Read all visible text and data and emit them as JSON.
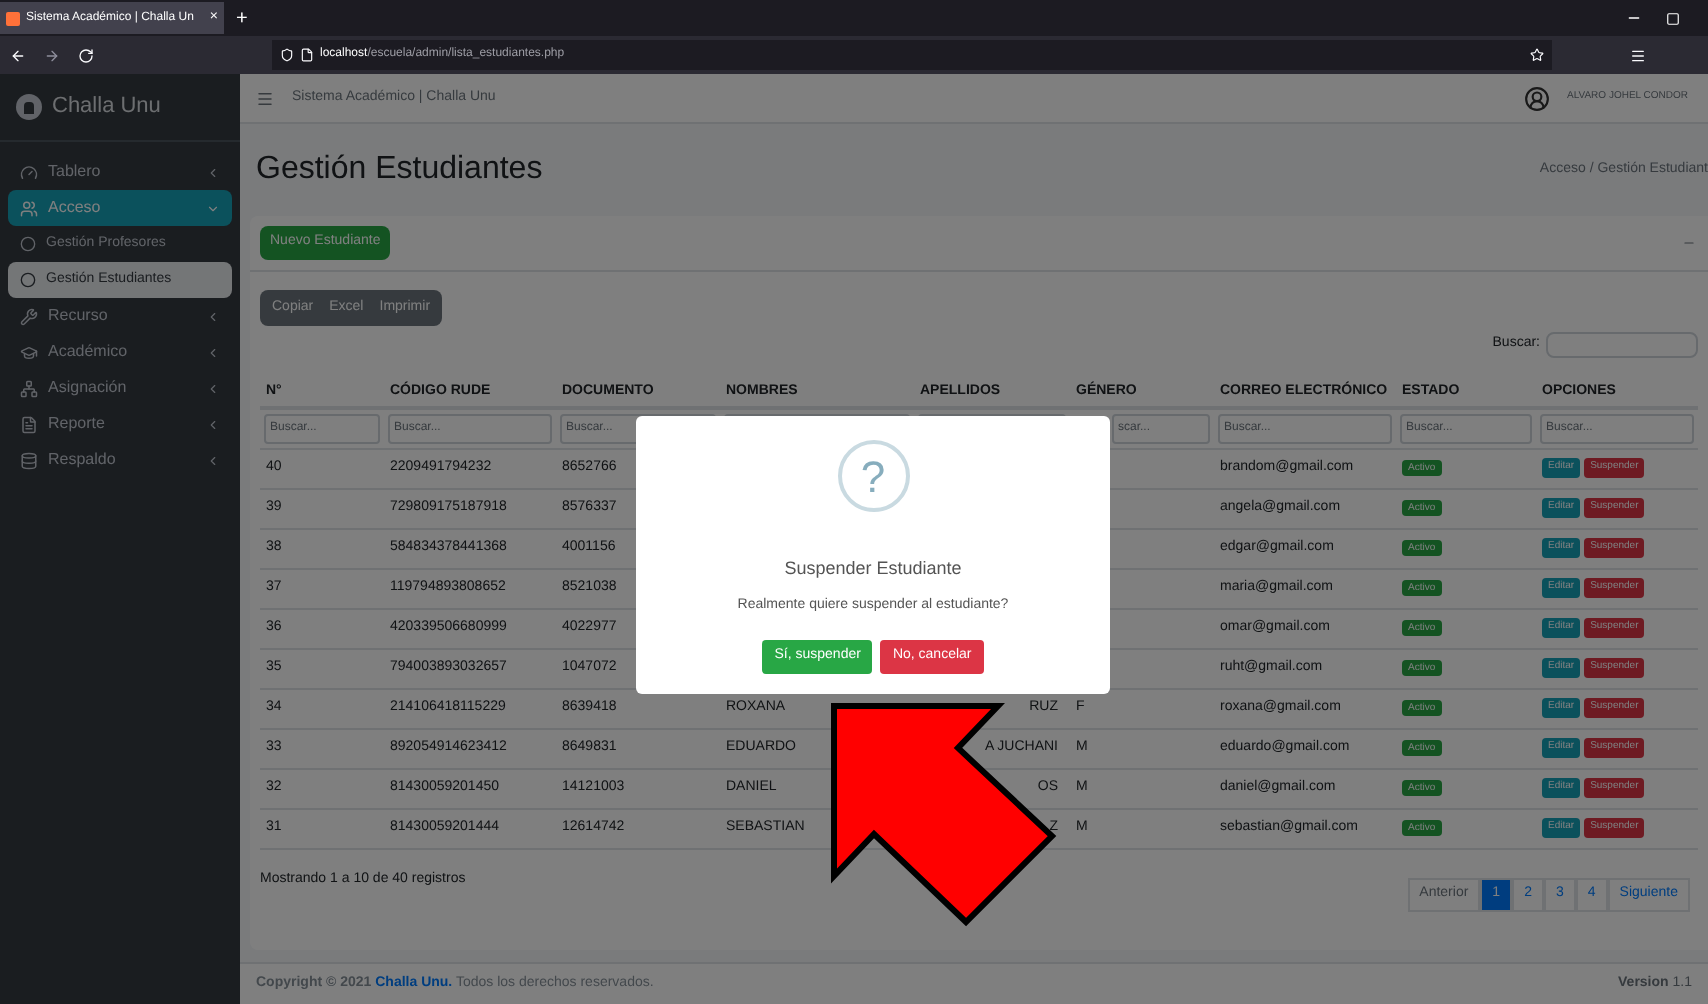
{
  "browser": {
    "tab_title": "Sistema Académico | Challa Un",
    "tab_close": "×",
    "new_tab": "+",
    "url_host": "localhost",
    "url_path": "/escuela/admin/lista_estudiantes.php"
  },
  "sidebar": {
    "brand": "Challa Unu",
    "items": [
      {
        "label": "Tablero",
        "selected": false,
        "expanded": false
      },
      {
        "label": "Acceso",
        "selected": true,
        "expanded": true,
        "children": [
          {
            "label": "Gestión Profesores",
            "selected": false
          },
          {
            "label": "Gestión Estudiantes",
            "selected": true
          }
        ]
      },
      {
        "label": "Recurso",
        "selected": false,
        "expanded": false
      },
      {
        "label": "Académico",
        "selected": false,
        "expanded": false
      },
      {
        "label": "Asignación",
        "selected": false,
        "expanded": false
      },
      {
        "label": "Reporte",
        "selected": false,
        "expanded": false
      },
      {
        "label": "Respaldo",
        "selected": false,
        "expanded": false
      }
    ]
  },
  "navbar": {
    "title": "Sistema Académico | Challa Unu",
    "user": "ALVARO JOHEL CONDOR"
  },
  "header": {
    "title": "Gestión Estudiantes",
    "breadcrumb": [
      "Acceso",
      "Gestión Estudiant"
    ],
    "separator": "/"
  },
  "card": {
    "new_button": "Nuevo Estudiante",
    "export_buttons": [
      "Copiar",
      "Excel",
      "Imprimir"
    ],
    "search_label": "Buscar:"
  },
  "table": {
    "columns": [
      "N°",
      "CÓDIGO RUDE",
      "DOCUMENTO",
      "NOMBRES",
      "APELLIDOS",
      "GÉNERO",
      "CORREO ELECTRÓNICO",
      "ESTADO",
      "OPCIONES"
    ],
    "filters": [
      {
        "placeholder": "Buscar..."
      },
      {
        "placeholder": "Buscar..."
      },
      {
        "placeholder": "Buscar..."
      },
      {
        "kind": "blank"
      },
      {
        "kind": "blank"
      },
      {
        "placeholder": "scar..."
      },
      {
        "placeholder": "Buscar..."
      },
      {
        "placeholder": "Buscar..."
      },
      {
        "placeholder": "Buscar..."
      }
    ],
    "rows": [
      {
        "cells": [
          "40",
          "2209491794232",
          "8652766",
          null,
          null,
          null,
          "brandom@gmail.com"
        ],
        "estado": "Activo",
        "actions": [
          {
            "kind": "edit",
            "label": "Editar"
          },
          {
            "kind": "suspend",
            "label": "Suspender"
          }
        ]
      },
      {
        "cells": [
          "39",
          "729809175187918",
          "8576337",
          null,
          null,
          null,
          "angela@gmail.com"
        ],
        "estado": "Activo",
        "actions": [
          {
            "kind": "edit",
            "label": "Editar"
          },
          {
            "kind": "suspend",
            "label": "Suspender"
          }
        ]
      },
      {
        "cells": [
          "38",
          "584834378441368",
          "4001156",
          null,
          null,
          null,
          "edgar@gmail.com"
        ],
        "estado": "Activo",
        "actions": [
          {
            "kind": "edit",
            "label": "Editar"
          },
          {
            "kind": "suspend",
            "label": "Suspender"
          }
        ]
      },
      {
        "cells": [
          "37",
          "119794893808652",
          "8521038",
          null,
          null,
          null,
          "maria@gmail.com"
        ],
        "estado": "Activo",
        "actions": [
          {
            "kind": "edit",
            "label": "Editar"
          },
          {
            "kind": "suspend",
            "label": "Suspender"
          }
        ]
      },
      {
        "cells": [
          "36",
          "420339506680999",
          "4022977",
          null,
          null,
          null,
          "omar@gmail.com"
        ],
        "estado": "Activo",
        "actions": [
          {
            "kind": "edit",
            "label": "Editar"
          },
          {
            "kind": "suspend",
            "label": "Suspender"
          }
        ]
      },
      {
        "cells": [
          "35",
          "794003893032657",
          "1047072",
          null,
          null,
          null,
          "ruht@gmail.com"
        ],
        "estado": "Activo",
        "actions": [
          {
            "kind": "edit",
            "label": "Editar"
          },
          {
            "kind": "suspend",
            "label": "Suspender"
          }
        ]
      },
      {
        "cells": [
          "34",
          "214106418115229",
          "8639418",
          "ROXANA",
          "RUZ",
          "F",
          "roxana@gmail.com"
        ],
        "estado": "Activo",
        "actions": [
          {
            "kind": "edit",
            "label": "Editar"
          },
          {
            "kind": "suspend",
            "label": "Suspender"
          }
        ]
      },
      {
        "cells": [
          "33",
          "892054914623412",
          "8649831",
          "EDUARDO",
          "A JUCHANI",
          "M",
          "eduardo@gmail.com"
        ],
        "estado": "Activo",
        "actions": [
          {
            "kind": "edit",
            "label": "Editar"
          },
          {
            "kind": "suspend",
            "label": "Suspender"
          }
        ]
      },
      {
        "cells": [
          "32",
          "81430059201450",
          "14121003",
          "DANIEL",
          "OS",
          "M",
          "daniel@gmail.com"
        ],
        "estado": "Activo",
        "actions": [
          {
            "kind": "edit",
            "label": "Editar"
          },
          {
            "kind": "suspend",
            "label": "Suspender"
          }
        ]
      },
      {
        "cells": [
          "31",
          "81430059201444",
          "12614742",
          "SEBASTIAN",
          "Z",
          "M",
          "sebastian@gmail.com"
        ],
        "estado": "Activo",
        "actions": [
          {
            "kind": "edit",
            "label": "Editar"
          },
          {
            "kind": "suspend",
            "label": "Suspender"
          }
        ]
      }
    ]
  },
  "info": "Mostrando 1 a 10 de 40 registros",
  "pagination": [
    {
      "label": "Anterior",
      "selected": false,
      "disabled": true
    },
    {
      "label": "1",
      "selected": true,
      "disabled": false
    },
    {
      "label": "2",
      "selected": false,
      "disabled": false
    },
    {
      "label": "3",
      "selected": false,
      "disabled": false
    },
    {
      "label": "4",
      "selected": false,
      "disabled": false
    },
    {
      "label": "Siguiente",
      "selected": false,
      "disabled": false
    }
  ],
  "footer": {
    "copyright": "Copyright © 2021",
    "brand": "Challa Unu.",
    "rights": "Todos los derechos reservados.",
    "version_label": "Version",
    "version": "1.1"
  },
  "modal": {
    "icon": "?",
    "title": "Suspender Estudiante",
    "text": "Realmente quiere suspender al estudiante?",
    "confirm": "Sí, suspender",
    "cancel": "No, cancelar"
  }
}
